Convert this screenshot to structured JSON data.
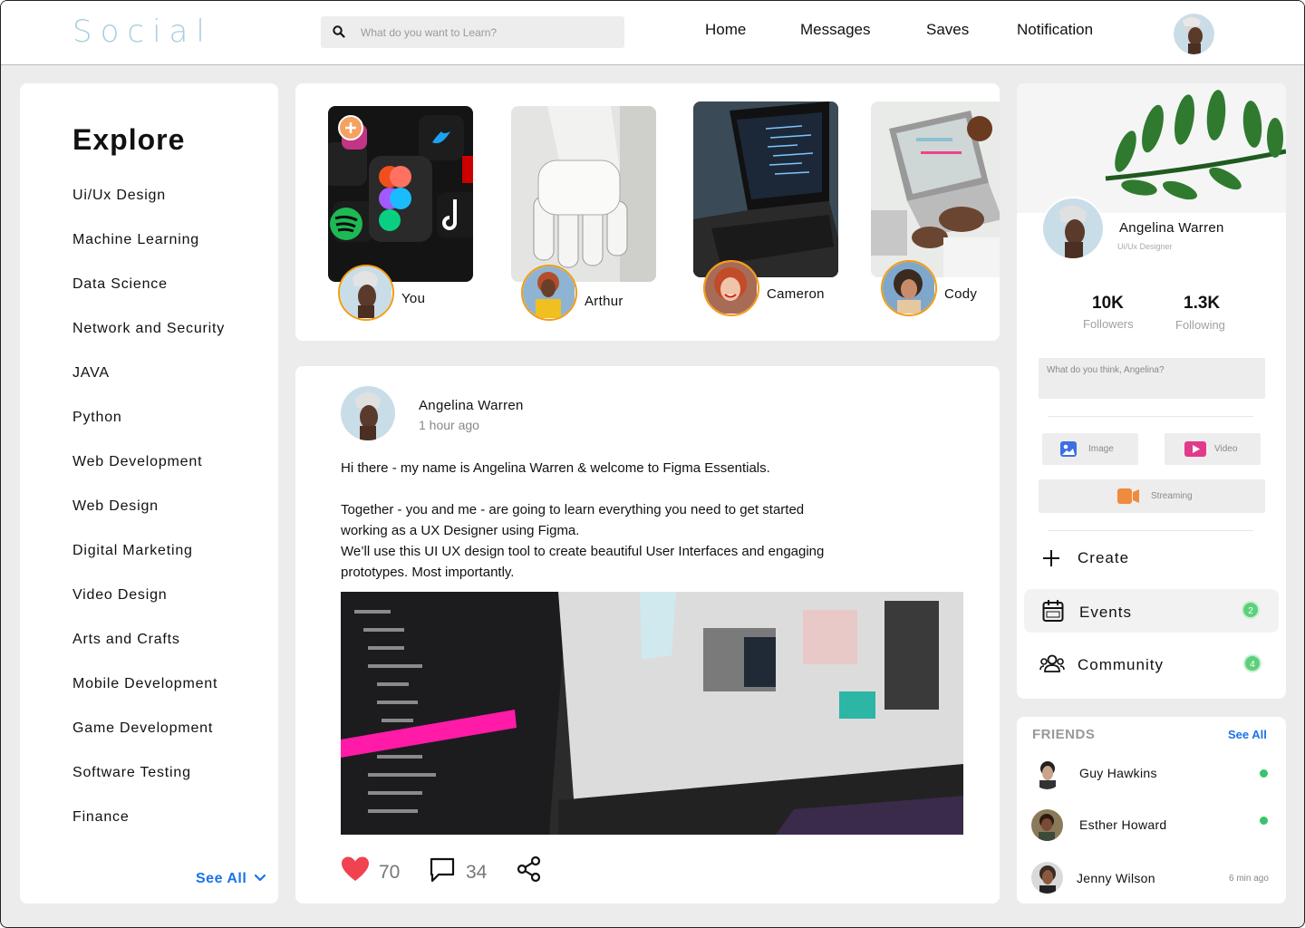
{
  "header": {
    "logo": "Social",
    "search_placeholder": "What do you want to Learn?",
    "nav": [
      "Home",
      "Messages",
      "Saves",
      "Notification"
    ]
  },
  "explore": {
    "title": "Explore",
    "topics": [
      "Ui/Ux Design",
      "Machine Learning",
      "Data Science",
      "Network and Security",
      "JAVA",
      "Python",
      "Web Development",
      "Web Design",
      "Digital Marketing",
      "Video Design",
      "Arts and Crafts",
      "Mobile Development",
      "Game Development",
      "Software Testing",
      "Finance"
    ],
    "see_all": "See All"
  },
  "stories": [
    {
      "name": "You"
    },
    {
      "name": "Arthur"
    },
    {
      "name": "Cameron"
    },
    {
      "name": "Cody"
    }
  ],
  "post": {
    "author": "Angelina Warren",
    "time": "1 hour ago",
    "paragraph1": "Hi there - my name is Angelina Warren & welcome to Figma Essentials.",
    "paragraph2_lines": [
      "Together - you and me - are going to learn everything you need to get started",
      "working as a UX Designer using Figma.",
      "We’ll use this UI UX design tool to create beautiful User Interfaces and engaging",
      "prototypes. Most importantly."
    ],
    "likes": "70",
    "comments": "34"
  },
  "profile": {
    "name": "Angelina Warren",
    "role": "Ui/Ux Designer",
    "followers_count": "10K",
    "followers_label": "Followers",
    "following_count": "1.3K",
    "following_label": "Following",
    "composer_placeholder": "What do you think, Angelina?",
    "media": {
      "image": "Image",
      "video": "Video",
      "streaming": "Streaming"
    },
    "menu": {
      "create": "Create",
      "events": "Events",
      "events_badge": "2",
      "community": "Community",
      "community_badge": "4"
    }
  },
  "friends": {
    "title": "FRIENDS",
    "see_all": "See All",
    "list": [
      {
        "name": "Guy Hawkins",
        "status": "online"
      },
      {
        "name": "Esther Howard",
        "status": "online"
      },
      {
        "name": "Jenny Wilson",
        "status": "6 min ago"
      }
    ]
  },
  "colors": {
    "accent_blue": "#1a73e8",
    "logo": "#a9cde0",
    "story_ring": "#f39c12",
    "online_green": "#36c56a",
    "badge_green": "#5cd07b",
    "like_red": "#f0424f"
  },
  "icons": [
    "search-icon",
    "plus-icon",
    "heart-icon",
    "comment-icon",
    "share-icon",
    "image-icon",
    "video-icon",
    "streaming-icon",
    "calendar-icon",
    "community-icon",
    "chevron-down-icon"
  ]
}
